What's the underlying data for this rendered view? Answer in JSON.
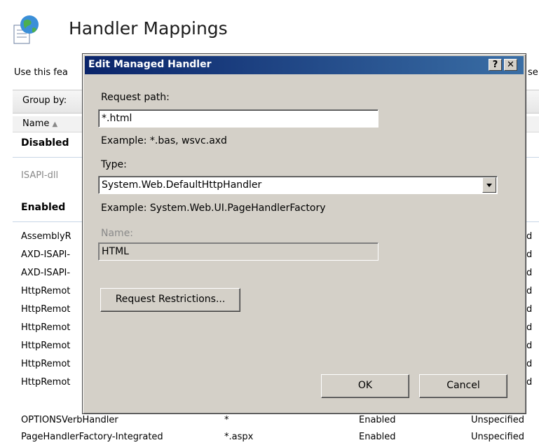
{
  "page": {
    "title": "Handler Mappings",
    "description_partial": "Use this fea",
    "description_tail": "se",
    "group_by_label": "Group by:",
    "name_column": "Name",
    "group_disabled": "Disabled",
    "group_enabled": "Enabled",
    "disabled_rows": [
      "ISAPI-dll"
    ],
    "enabled_rows": [
      "AssemblyR",
      "AXD-ISAPI-",
      "AXD-ISAPI-",
      "HttpRemot",
      "HttpRemot",
      "HttpRemot",
      "HttpRemot",
      "HttpRemot",
      "HttpRemot"
    ],
    "right_col_char": "d",
    "bottom_rows": [
      {
        "name": "OPTIONSVerbHandler",
        "path": "*",
        "state": "Enabled",
        "type": "Unspecified"
      },
      {
        "name": "PageHandlerFactory-Integrated",
        "path": "*.aspx",
        "state": "Enabled",
        "type": "Unspecified"
      }
    ]
  },
  "dialog": {
    "title": "Edit Managed Handler",
    "help_button": "?",
    "close_button": "✕",
    "request_path_label": "Request path:",
    "request_path_value": "*.html",
    "request_path_example": "Example: *.bas, wsvc.axd",
    "type_label": "Type:",
    "type_value": "System.Web.DefaultHttpHandler",
    "type_example": "Example: System.Web.UI.PageHandlerFactory",
    "name_label": "Name:",
    "name_value": "HTML",
    "restrictions_button": "Request Restrictions...",
    "ok_button": "OK",
    "cancel_button": "Cancel"
  },
  "colors": {
    "titlebar_start": "#0a246a",
    "titlebar_end": "#3a6ea5",
    "dialog_face": "#d4d0c8"
  }
}
